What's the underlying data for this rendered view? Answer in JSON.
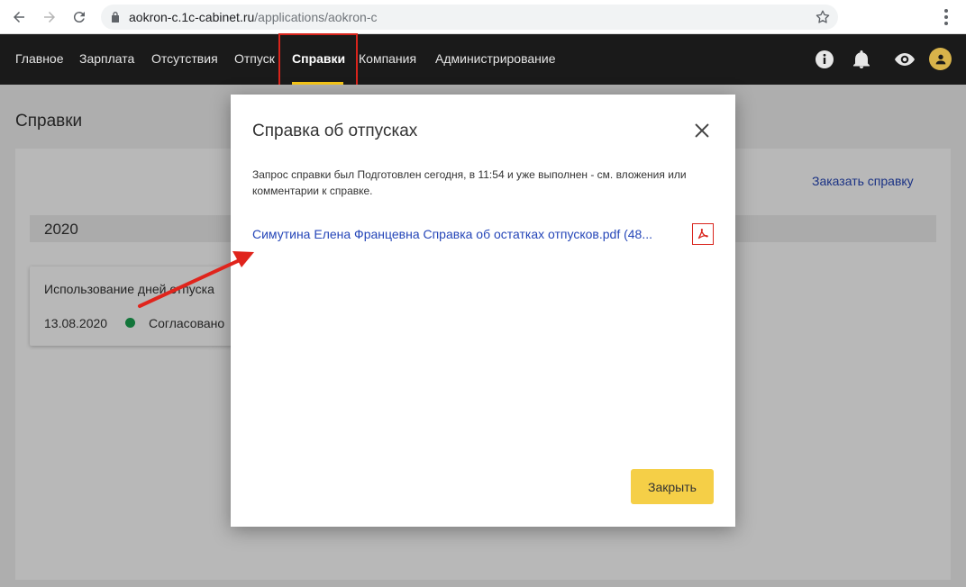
{
  "browser": {
    "url_host": "aokron-c.1c-cabinet.ru",
    "url_path": "/applications/aokron-c"
  },
  "nav": {
    "items": [
      {
        "label": "Главное"
      },
      {
        "label": "Зарплата"
      },
      {
        "label": "Отсутствия"
      },
      {
        "label": "Отпуск"
      },
      {
        "label": "Справки",
        "active": true
      },
      {
        "label": "Компания"
      },
      {
        "label": "Администрирование"
      }
    ]
  },
  "page": {
    "title": "Справки",
    "order_link": "Заказать справку",
    "year": "2020",
    "card": {
      "title": "Использование дней отпуска",
      "date": "13.08.2020",
      "status": "Согласовано"
    }
  },
  "modal": {
    "title": "Справка об отпусках",
    "message": "Запрос справки был Подготовлен сегодня, в 11:54 и уже выполнен - см. вложения или комментарии к справке.",
    "file_link": "Симутина Елена Францевна Справка об остатках отпусков.pdf  (48...",
    "close_button": "Закрыть"
  },
  "colors": {
    "accent": "#f5c518",
    "link": "#2546b8",
    "highlight": "#d9241c",
    "status_ok": "#1aa251"
  }
}
